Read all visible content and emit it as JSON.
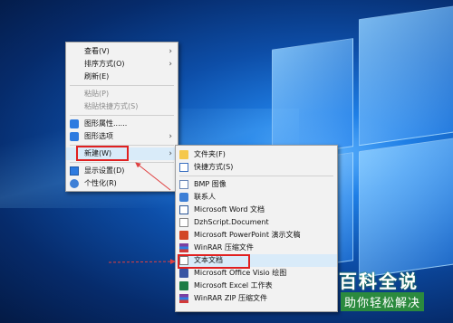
{
  "main_menu": {
    "items": [
      {
        "label": "查看(V)",
        "arrow": "›"
      },
      {
        "label": "排序方式(O)",
        "arrow": "›"
      },
      {
        "label": "刷新(E)"
      },
      {
        "label": "粘贴(P)"
      },
      {
        "label": "粘贴快捷方式(S)"
      },
      {
        "label": "图形属性......"
      },
      {
        "label": "图形选项",
        "arrow": "›"
      },
      {
        "label": "新建(W)",
        "arrow": "›"
      },
      {
        "label": "显示设置(D)"
      },
      {
        "label": "个性化(R)"
      }
    ]
  },
  "sub_menu": {
    "items": [
      {
        "label": "文件夹(F)",
        "icon": "folder-icon"
      },
      {
        "label": "快捷方式(S)",
        "icon": "shortcut-icon"
      },
      {
        "label": "BMP 图像",
        "icon": "bmp-image-icon"
      },
      {
        "label": "联系人",
        "icon": "contact-icon"
      },
      {
        "label": "Microsoft Word 文档",
        "icon": "word-document-icon"
      },
      {
        "label": "DzhScript.Document",
        "icon": "document-icon"
      },
      {
        "label": "Microsoft PowerPoint 演示文稿",
        "icon": "powerpoint-icon"
      },
      {
        "label": "WinRAR 压缩文件",
        "icon": "winrar-icon"
      },
      {
        "label": "文本文档",
        "icon": "text-document-icon"
      },
      {
        "label": "Microsoft Office Visio 绘图",
        "icon": "visio-icon"
      },
      {
        "label": "Microsoft Excel 工作表",
        "icon": "excel-icon"
      },
      {
        "label": "WinRAR ZIP 压缩文件",
        "icon": "winrar-zip-icon"
      }
    ]
  },
  "watermark": {
    "title": "百科全说",
    "subtitle": "助你轻松解决"
  },
  "colors": {
    "highlight_box": "#e02020",
    "menu_background": "#f2f2f2",
    "watermark_green": "#2b8a3e"
  }
}
